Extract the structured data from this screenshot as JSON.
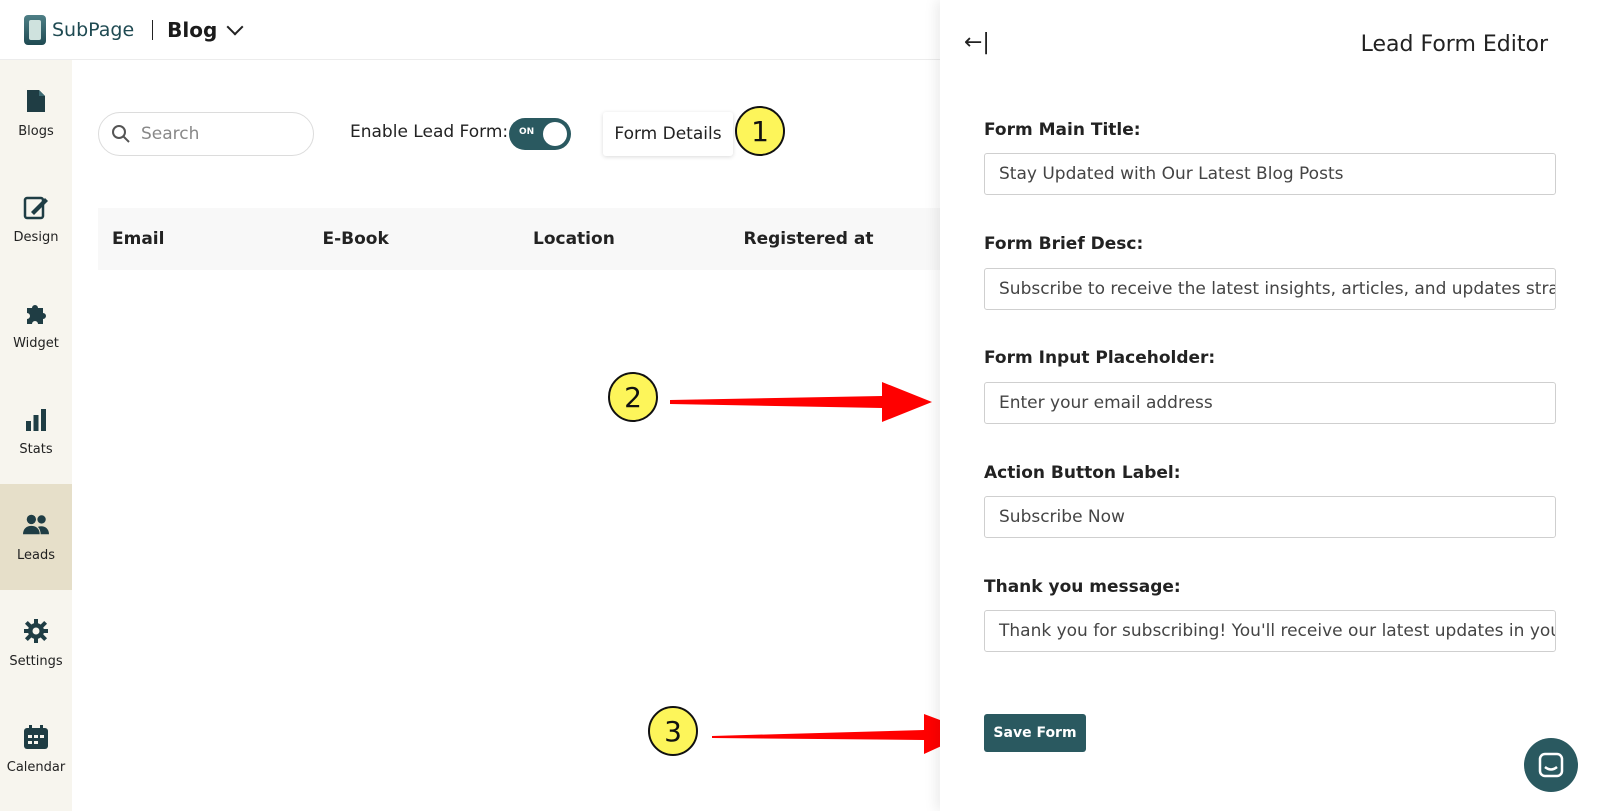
{
  "header": {
    "logo_text": "SubPage",
    "section_title": "Blog"
  },
  "sidebar": {
    "items": [
      {
        "label": "Blogs",
        "icon": "document-icon"
      },
      {
        "label": "Design",
        "icon": "design-icon"
      },
      {
        "label": "Widget",
        "icon": "puzzle-icon"
      },
      {
        "label": "Stats",
        "icon": "bar-chart-icon"
      },
      {
        "label": "Leads",
        "icon": "users-icon",
        "active": true
      },
      {
        "label": "Settings",
        "icon": "gear-icon"
      },
      {
        "label": "Calendar",
        "icon": "calendar-icon"
      }
    ]
  },
  "toolbar": {
    "search_placeholder": "Search",
    "enable_label": "Enable Lead Form:",
    "toggle_state": "ON",
    "form_details_label": "Form Details"
  },
  "table": {
    "columns": [
      "Email",
      "E-Book",
      "Location",
      "Registered at"
    ]
  },
  "annotations": {
    "markers": [
      "1",
      "2",
      "3"
    ]
  },
  "panel": {
    "title": "Lead Form Editor",
    "fields": [
      {
        "label": "Form Main Title:",
        "value": "Stay Updated with Our Latest Blog Posts"
      },
      {
        "label": "Form Brief Desc:",
        "value": "Subscribe to receive the latest insights, articles, and updates straight"
      },
      {
        "label": "Form Input Placeholder:",
        "value": "Enter your email address"
      },
      {
        "label": "Action Button Label:",
        "value": "Subscribe Now"
      },
      {
        "label": "Thank you message:",
        "value": "Thank you for subscribing! You'll receive our latest updates in your inl"
      }
    ],
    "save_label": "Save Form"
  },
  "colors": {
    "brand": "#2a5960",
    "sidebar_bg": "#f7f5ee",
    "sidebar_active": "#e6dfc9",
    "marker": "#fdf55a",
    "arrow": "#ff0000"
  }
}
